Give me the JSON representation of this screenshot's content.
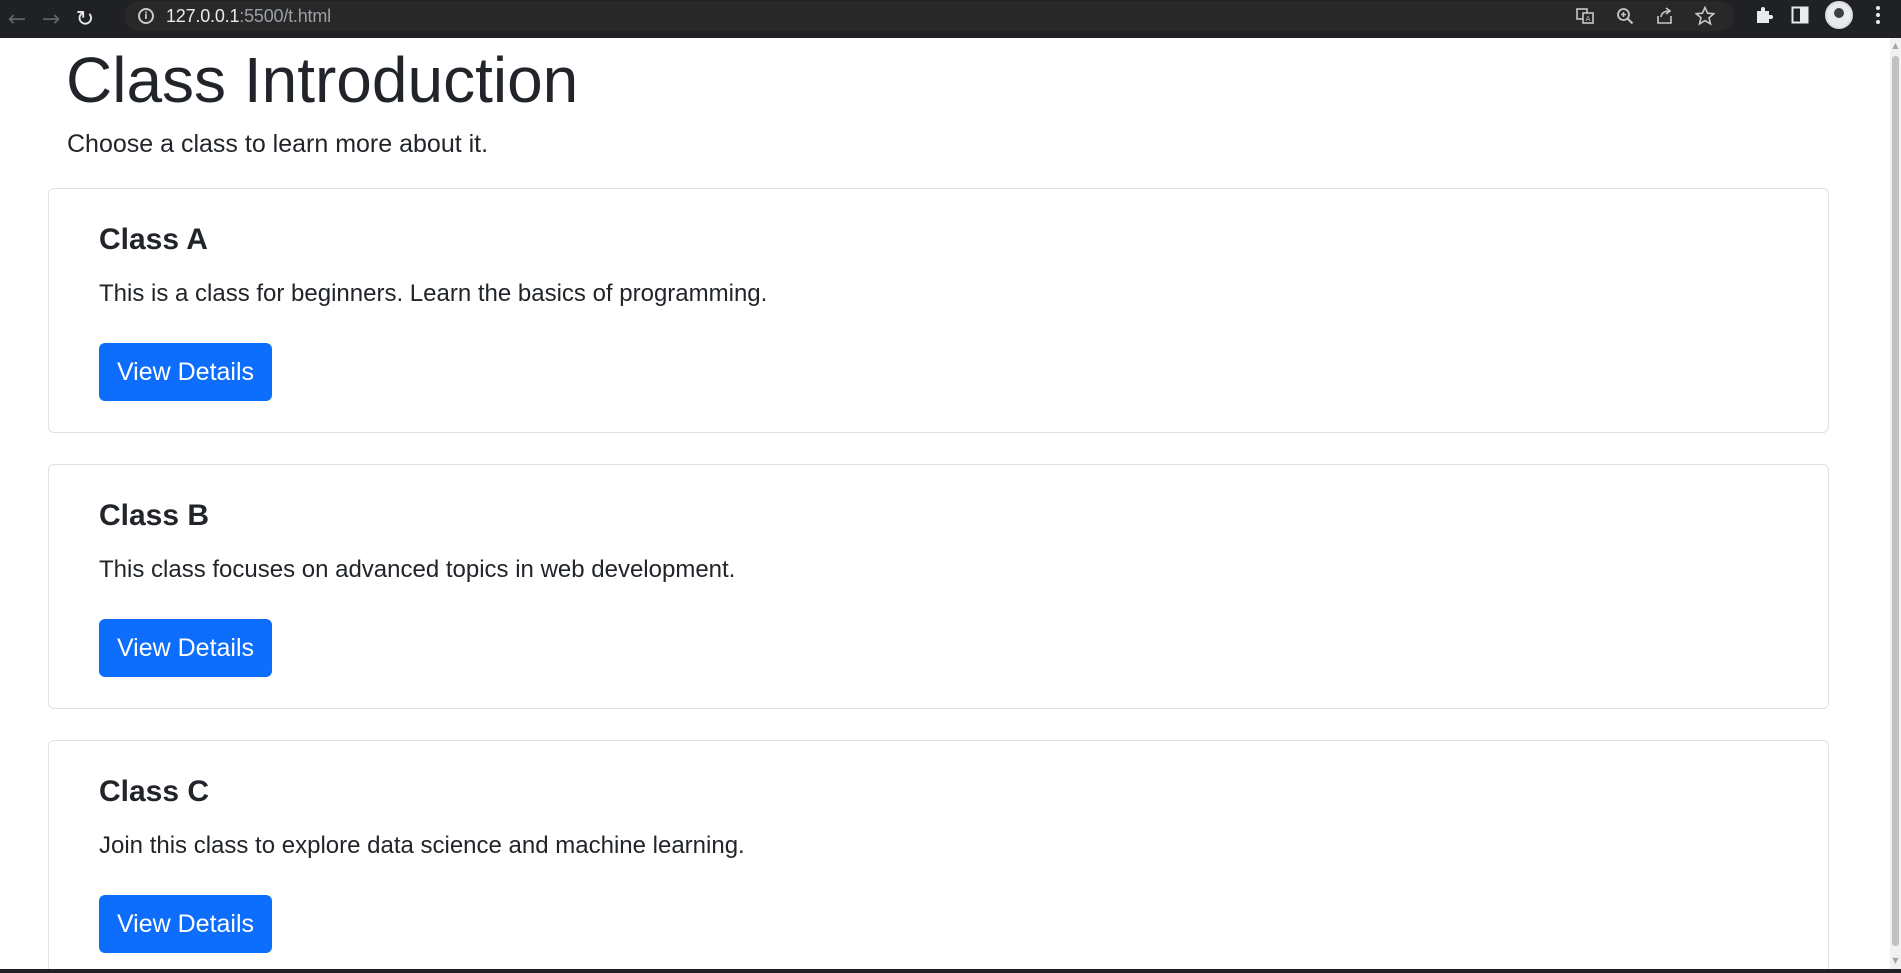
{
  "browser": {
    "back_icon": "arrow-left",
    "forward_icon": "arrow-right",
    "reload_icon": "reload",
    "url_host": "127.0.0.1",
    "url_rest": ":5500/t.html",
    "toolbar_icons": [
      "translate-icon",
      "zoom-icon",
      "share-icon",
      "bookmark-star-icon",
      "extensions-icon",
      "side-panel-icon",
      "profile-avatar",
      "menu-icon"
    ]
  },
  "page": {
    "title": "Class Introduction",
    "subtitle": "Choose a class to learn more about it."
  },
  "classes": [
    {
      "title": "Class A",
      "description": "This is a class for beginners. Learn the basics of programming.",
      "button_label": "View Details"
    },
    {
      "title": "Class B",
      "description": "This class focuses on advanced topics in web development.",
      "button_label": "View Details"
    },
    {
      "title": "Class C",
      "description": "Join this class to explore data science and machine learning.",
      "button_label": "View Details"
    }
  ],
  "colors": {
    "primary_button": "#0d6efd",
    "text": "#212529",
    "card_border": "#dee2e6",
    "chrome_bg": "#202124"
  }
}
